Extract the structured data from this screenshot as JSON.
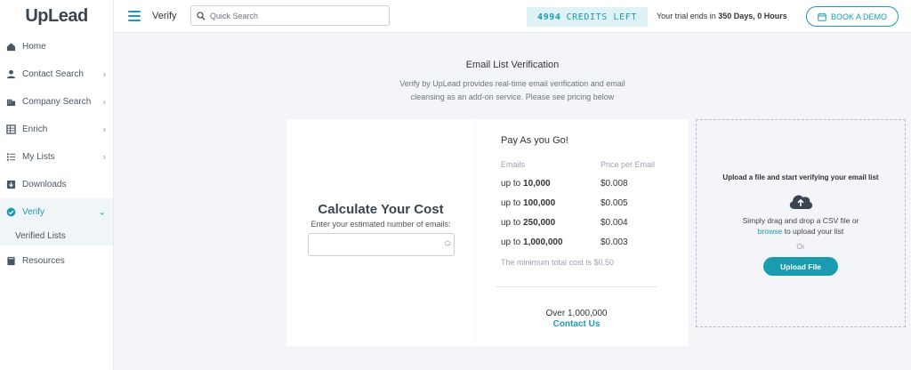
{
  "brand": {
    "logo_up": "Up",
    "logo_lead": "Lead"
  },
  "sidebar": {
    "items": [
      {
        "label": "Home",
        "icon": "home-icon"
      },
      {
        "label": "Contact Search",
        "icon": "person-icon",
        "chevron": ">"
      },
      {
        "label": "Company Search",
        "icon": "building-icon",
        "chevron": ">"
      },
      {
        "label": "Enrich",
        "icon": "table-icon",
        "chevron": ">"
      },
      {
        "label": "My Lists",
        "icon": "list-icon",
        "chevron": ">"
      },
      {
        "label": "Downloads",
        "icon": "download-icon"
      },
      {
        "label": "Verify",
        "icon": "check-circle-icon",
        "chevron": "v",
        "active": true
      },
      {
        "label": "Resources",
        "icon": "book-icon"
      }
    ],
    "sub_items": [
      {
        "label": "Verified Lists"
      }
    ]
  },
  "header": {
    "page_label": "Verify",
    "search_placeholder": "Quick Search",
    "credits_count": "4994",
    "credits_label": "CREDITS LEFT",
    "trial_prefix": "Your trial ends in",
    "trial_value": "350 Days, 0 Hours",
    "demo_label": "BOOK A DEMO"
  },
  "main": {
    "title": "Email List Verification",
    "subtitle_line1": "Verify by UpLead provides real-time email verification and email",
    "subtitle_line2": "cleansing as an add-on service. Please see pricing below"
  },
  "calculator": {
    "title": "Calculate Your Cost",
    "subtitle": "Enter your estimated number of emails:",
    "input_value": ""
  },
  "pricing": {
    "title": "Pay As you Go!",
    "col_emails": "Emails",
    "col_price": "Price per Email",
    "rows": [
      {
        "prefix": "up to",
        "amount": "10,000",
        "price": "$0.008"
      },
      {
        "prefix": "up to",
        "amount": "100,000",
        "price": "$0.005"
      },
      {
        "prefix": "up to",
        "amount": "250,000",
        "price": "$0.004"
      },
      {
        "prefix": "up to",
        "amount": "1,000,000",
        "price": "$0.003"
      }
    ],
    "min_cost": "The minimum total cost is $0.50",
    "over_label": "Over 1,000,000",
    "contact_label": "Contact Us"
  },
  "upload": {
    "title": "Upload a file and start verifying your email list",
    "text_line1": "Simply drag and drop a CSV file or",
    "browse_label": "browse",
    "text_line2_rest": "to upload your list",
    "or_label": "Or",
    "button_label": "Upload File"
  },
  "colors": {
    "accent": "#1a9bb0",
    "credits_bg": "#dff2f6",
    "page_bg": "#f3f5f8"
  }
}
